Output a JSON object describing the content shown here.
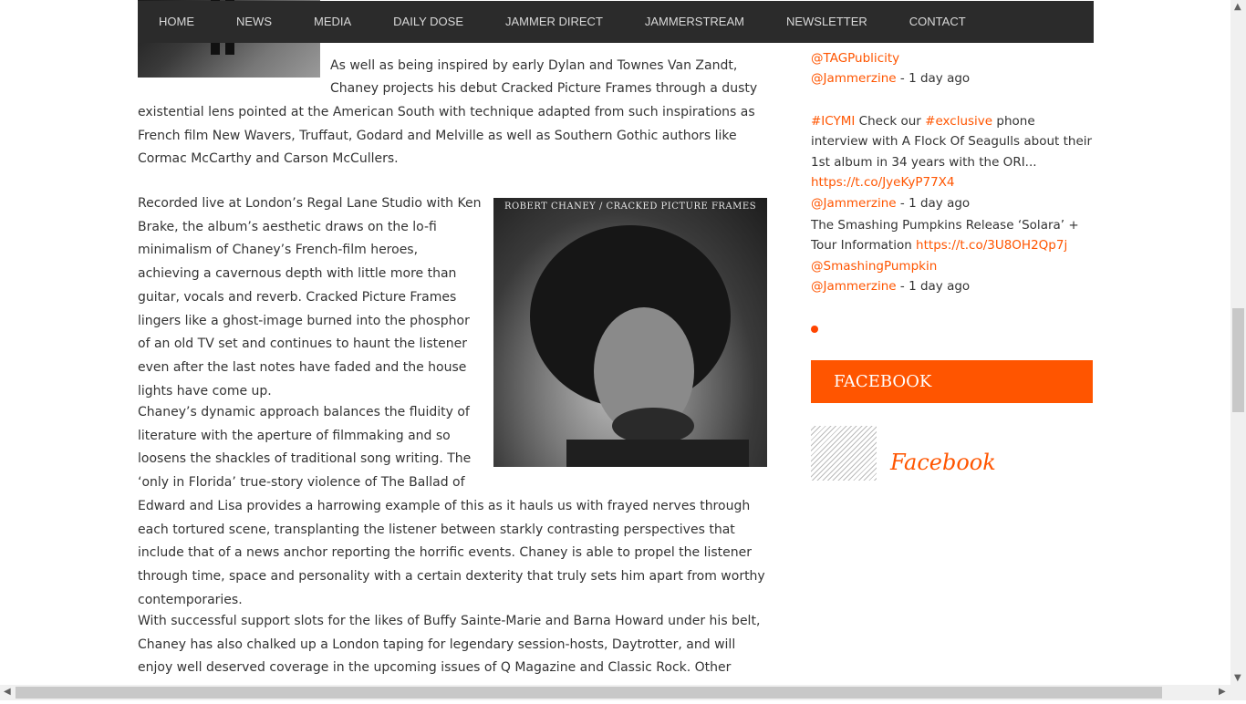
{
  "nav": {
    "items": [
      "HOME",
      "NEWS",
      "MEDIA",
      "DAILY DOSE",
      "JAMMER DIRECT",
      "JAMMERSTREAM",
      "NEWSLETTER",
      "CONTACT"
    ]
  },
  "article": {
    "p1_line1": "As well as being inspired by early Dylan and Townes Van Zandt,",
    "p1_line2": "Chaney projects his debut Cracked Picture Frames through a dusty",
    "p1_rest": "existential lens pointed at the American South with technique adapted from such inspirations as French film New Wavers, Truffaut, Godard and Melville as well as Southern Gothic authors like Cormac McCarthy and Carson McCullers.",
    "p2": "Recorded live at London’s Regal Lane Studio with Ken Brake, the album’s aesthetic draws on the lo-fi minimalism of Chaney’s French-film heroes, achieving a cavernous depth with little more than guitar, vocals and reverb. Cracked Picture Frames lingers like a ghost-image burned into the phosphor of an old TV set and continues to haunt the listener even after the last notes have faded and the house lights have come up.",
    "p3_wrap": "Chaney’s dynamic approach balances the fluidity of literature with the aperture of filmmaking and so loosens the shackles of traditional song writing. The ‘only in Florida’ true-story violence of The Ballad of",
    "p3_full": "Edward and Lisa provides a harrowing example of this as it hauls us with frayed nerves through each tortured scene, transplanting the listener between starkly contrasting perspectives that include that of a news anchor reporting the horrific events. Chaney is able to propel the listener through time, space and personality with a certain dexterity that truly sets him apart from worthy contemporaries.",
    "p4": "With successful support slots for the likes of Buffy Sainte-Marie and Barna Howard under his belt, Chaney has also chalked up a London taping for legendary session-hosts, Daytrotter, and will enjoy well deserved coverage in the upcoming issues of Q Magazine and Classic Rock. Other influences –",
    "album_caption": "ROBERT CHANEY  /  CRACKED PICTURE FRAMES"
  },
  "sidebar": {
    "tweet1": {
      "mention": "@TAGPublicity",
      "user": "@Jammerzine",
      "time": " - 1 day ago"
    },
    "tweet2": {
      "tag1": "#ICYMI",
      "t1": " Check our ",
      "tag2": "#exclusive",
      "t2": " phone interview with A Flock Of Seagulls about their 1st album in 34 years with the ORI... ",
      "link": "https://t.co/JyeKyP77X4",
      "user": "@Jammerzine",
      "time": " - 1 day ago"
    },
    "tweet3": {
      "text": "The Smashing Pumpkins Release ‘Solara’ + Tour Information ",
      "link": "https://t.co/3U8OH2Qp7j",
      "mention": "@SmashingPumpkin",
      "user": "@Jammerzine",
      "time": " - 1 day ago"
    },
    "facebook_header": "FACEBOOK",
    "facebook_link": "Facebook"
  },
  "colors": {
    "accent": "#ff5500",
    "nav_bg": "#2b2b2b"
  }
}
